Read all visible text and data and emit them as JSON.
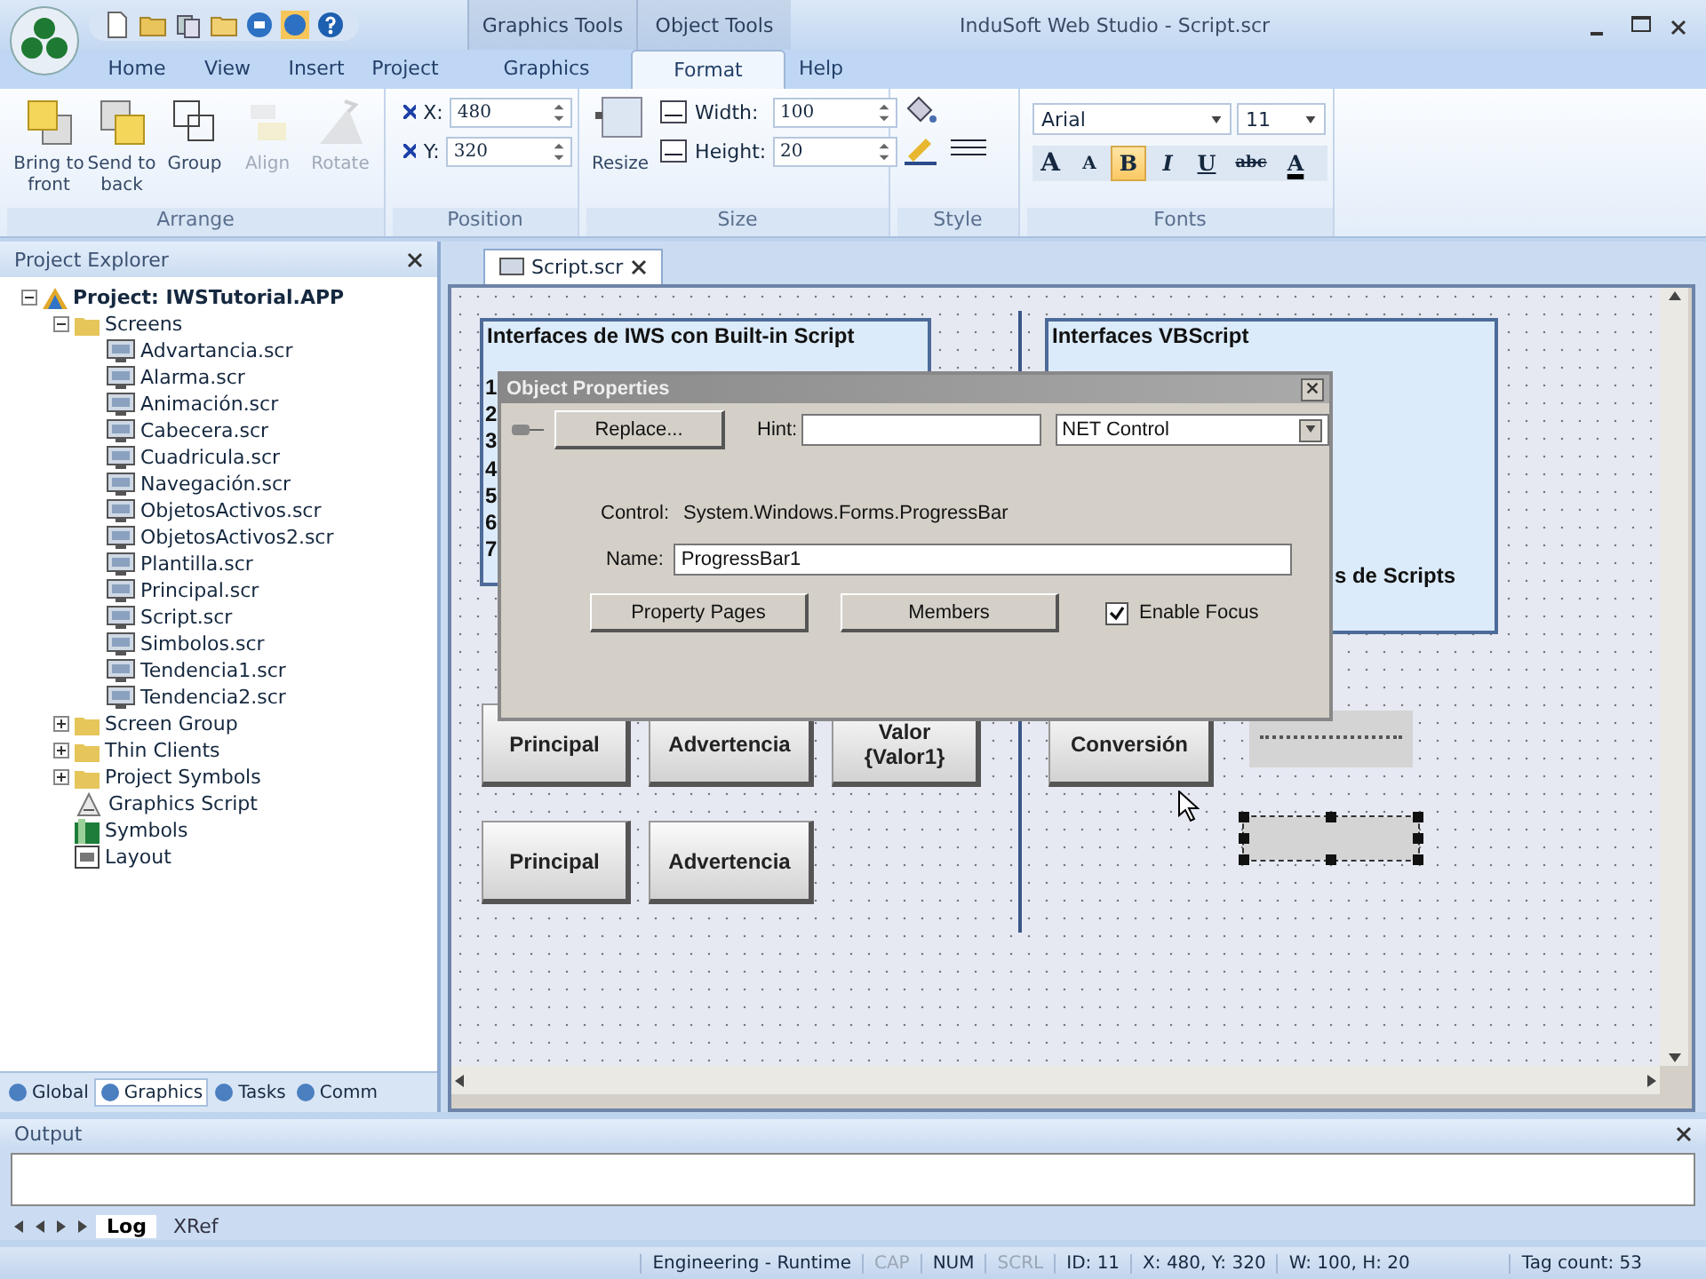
{
  "window": {
    "title": "InduSoft Web Studio - Script.scr"
  },
  "context_groups": [
    {
      "label": "Graphics Tools"
    },
    {
      "label": "Object Tools"
    }
  ],
  "ribbon_tabs": [
    {
      "label": "Home",
      "selected": false
    },
    {
      "label": "View",
      "selected": false
    },
    {
      "label": "Insert",
      "selected": false
    },
    {
      "label": "Project",
      "selected": false
    },
    {
      "label": "Graphics",
      "selected": false
    },
    {
      "label": "Format",
      "selected": true
    },
    {
      "label": "Help",
      "selected": false
    }
  ],
  "arrange": {
    "title": "Arrange",
    "buttons": [
      {
        "label": "Bring to front",
        "kind": "front",
        "disabled": false
      },
      {
        "label": "Send to back",
        "kind": "back",
        "disabled": false
      },
      {
        "label": "Group",
        "kind": "group",
        "disabled": false
      },
      {
        "label": "Align",
        "kind": "align",
        "disabled": true
      },
      {
        "label": "Rotate",
        "kind": "rotate",
        "disabled": true
      }
    ]
  },
  "position": {
    "title": "Position",
    "fields": [
      {
        "label": "X:",
        "value": "480"
      },
      {
        "label": "Y:",
        "value": "320"
      }
    ]
  },
  "size": {
    "title": "Size",
    "resize": "Resize",
    "fields": [
      {
        "label": "Width:",
        "value": "100"
      },
      {
        "label": "Height:",
        "value": "20"
      }
    ]
  },
  "style": {
    "title": "Style"
  },
  "fonts": {
    "title": "Fonts",
    "font": "Arial",
    "font_size": "11",
    "buttons": [
      {
        "glyph": "A",
        "kind": "grow",
        "selected": false
      },
      {
        "glyph": "A",
        "kind": "shrink",
        "selected": false
      },
      {
        "glyph": "B",
        "kind": "bold",
        "selected": true
      },
      {
        "glyph": "I",
        "kind": "italic",
        "selected": false
      },
      {
        "glyph": "U",
        "kind": "underline",
        "selected": false
      },
      {
        "glyph": "abc",
        "kind": "strike",
        "selected": false
      },
      {
        "glyph": "A",
        "kind": "color",
        "selected": false
      }
    ]
  },
  "project_explorer": {
    "title": "Project Explorer",
    "tree": [
      {
        "label": "Project: IWSTutorial.APP",
        "kind": "project",
        "expanded": true,
        "children": [
          {
            "label": "Screens",
            "kind": "folder",
            "expanded": true,
            "children": [
              {
                "label": "Advartancia.scr",
                "kind": "screen"
              },
              {
                "label": "Alarma.scr",
                "kind": "screen"
              },
              {
                "label": "Animación.scr",
                "kind": "screen"
              },
              {
                "label": "Cabecera.scr",
                "kind": "screen"
              },
              {
                "label": "Cuadricula.scr",
                "kind": "screen"
              },
              {
                "label": "Navegación.scr",
                "kind": "screen"
              },
              {
                "label": "ObjetosActivos.scr",
                "kind": "screen"
              },
              {
                "label": "ObjetosActivos2.scr",
                "kind": "screen"
              },
              {
                "label": "Plantilla.scr",
                "kind": "screen"
              },
              {
                "label": "Principal.scr",
                "kind": "screen"
              },
              {
                "label": "Script.scr",
                "kind": "screen"
              },
              {
                "label": "Simbolos.scr",
                "kind": "screen"
              },
              {
                "label": "Tendencia1.scr",
                "kind": "screen"
              },
              {
                "label": "Tendencia2.scr",
                "kind": "screen"
              }
            ]
          },
          {
            "label": "Screen Group",
            "kind": "folder",
            "expanded": false
          },
          {
            "label": "Thin Clients",
            "kind": "folder",
            "expanded": false
          },
          {
            "label": "Project Symbols",
            "kind": "folder",
            "expanded": false
          },
          {
            "label": "Graphics Script",
            "kind": "script"
          },
          {
            "label": "Symbols",
            "kind": "symbols"
          },
          {
            "label": "Layout",
            "kind": "layout"
          }
        ]
      }
    ],
    "tabs": [
      {
        "label": "Global",
        "selected": false
      },
      {
        "label": "Graphics",
        "selected": true
      },
      {
        "label": "Tasks",
        "selected": false
      },
      {
        "label": "Comm",
        "selected": false
      }
    ]
  },
  "document": {
    "tab": "Script.scr",
    "frames": [
      {
        "title": "Interfaces de IWS con Built-in Script",
        "lines": [
          "1",
          "2",
          "3",
          "4",
          "5",
          "6",
          "7"
        ]
      },
      {
        "title": "Interfaces VBScript",
        "lines": [
          "s de Scripts"
        ]
      }
    ],
    "buttons": [
      {
        "label": "Principal"
      },
      {
        "label": "Advertencia"
      },
      {
        "label": "Valor {Valor1}"
      },
      {
        "label": "Conversión"
      },
      {
        "label": "Principal"
      },
      {
        "label": "Advertencia"
      }
    ],
    "objects": [
      {
        "selected": false
      },
      {
        "selected": true
      }
    ]
  },
  "dialog": {
    "title": "Object Properties",
    "replace": "Replace...",
    "hint_label": "Hint:",
    "type": "NET Control",
    "control_label": "Control:",
    "control": "System.Windows.Forms.ProgressBar",
    "name_label": "Name:",
    "name": "ProgressBar1",
    "buttons": [
      "Property Pages",
      "Members"
    ],
    "enable_focus": {
      "label": "Enable Focus",
      "checked": true
    }
  },
  "output": {
    "title": "Output",
    "tabs": [
      {
        "label": "Log",
        "selected": true
      },
      {
        "label": "XRef",
        "selected": false
      }
    ]
  },
  "status_bar": [
    {
      "text": "Engineering - Runtime",
      "disabled": false
    },
    {
      "text": "CAP",
      "disabled": true
    },
    {
      "text": "NUM",
      "disabled": false
    },
    {
      "text": "SCRL",
      "disabled": true
    },
    {
      "text": "ID: 11",
      "disabled": false
    },
    {
      "text": "X: 480, Y: 320",
      "disabled": false
    },
    {
      "text": "W: 100, H: 20",
      "disabled": false
    },
    {
      "text": "Tag count: 53",
      "disabled": false
    }
  ]
}
